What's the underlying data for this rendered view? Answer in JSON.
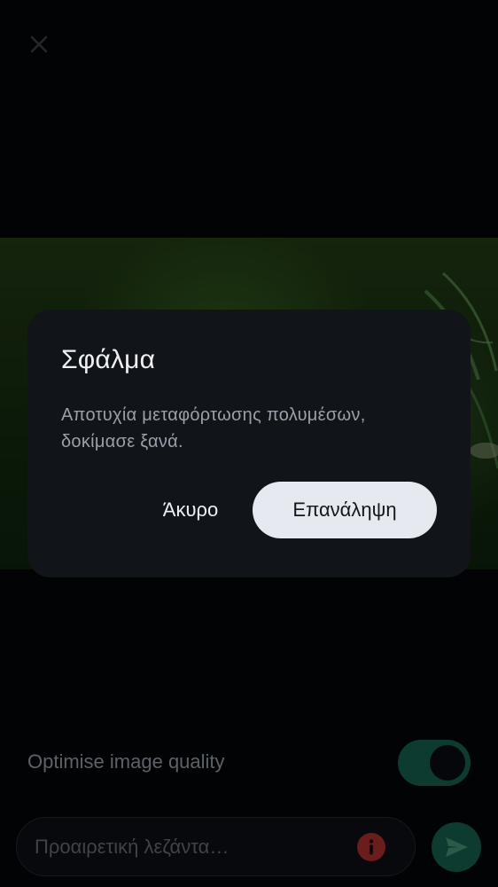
{
  "icons": {
    "close": "close-icon",
    "error": "error-icon",
    "send": "send-icon"
  },
  "dialog": {
    "title": "Σφάλμα",
    "message": "Αποτυχία μεταφόρτωσης πολυμέσων, δοκίμασε ξανά.",
    "cancel_label": "Άκυρο",
    "retry_label": "Επανάληψη"
  },
  "settings": {
    "optimise_label": "Optimise image quality",
    "optimise_enabled": true
  },
  "composer": {
    "caption_placeholder": "Προαιρετική λεζάντα…",
    "caption_value": ""
  },
  "colors": {
    "accent": "#0e3b30",
    "error": "#6b1c1c",
    "dialog_bg": "#111419",
    "retry_bg": "#e6e9ef"
  }
}
